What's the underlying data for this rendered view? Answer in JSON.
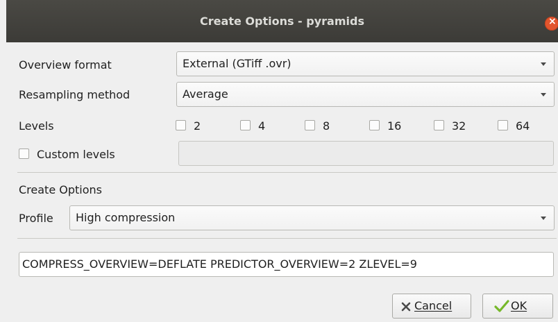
{
  "window": {
    "title": "Create Options - pyramids"
  },
  "overview_format": {
    "label": "Overview format",
    "value": "External (GTiff .ovr)"
  },
  "resampling": {
    "label": "Resampling method",
    "value": "Average"
  },
  "levels": {
    "label": "Levels",
    "options": [
      {
        "label": "2",
        "checked": false
      },
      {
        "label": "4",
        "checked": false
      },
      {
        "label": "8",
        "checked": false
      },
      {
        "label": "16",
        "checked": false
      },
      {
        "label": "32",
        "checked": false
      },
      {
        "label": "64",
        "checked": false
      }
    ]
  },
  "custom_levels": {
    "label": "Custom levels",
    "checked": false,
    "value": ""
  },
  "create_options": {
    "heading": "Create Options",
    "profile_label": "Profile",
    "profile_value": "High compression",
    "options_text": "COMPRESS_OVERVIEW=DEFLATE PREDICTOR_OVERVIEW=2 ZLEVEL=9"
  },
  "buttons": {
    "cancel_label": "Cancel",
    "ok_label": "OK"
  },
  "icons": {
    "close": "close-icon",
    "cancel": "x-icon",
    "ok": "checkmark-icon"
  },
  "colors": {
    "titlebar": "#3c3b37",
    "close": "#e2552d",
    "ok_check": "#76b82a"
  }
}
